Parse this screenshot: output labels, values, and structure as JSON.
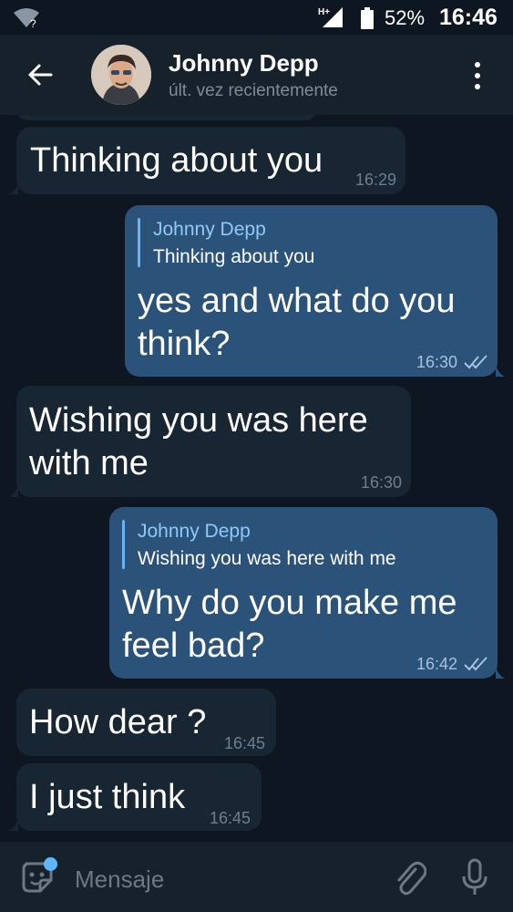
{
  "status_bar": {
    "wifi_icon": "wifi-unknown-icon",
    "network": "H+",
    "battery_percent": "52%",
    "time": "16:46"
  },
  "header": {
    "contact_name": "Johnny Depp",
    "last_seen": "últ. vez recientemente"
  },
  "messages": [
    {
      "direction": "in",
      "text": "Thinking about you",
      "time": "16:29"
    },
    {
      "direction": "out",
      "reply_name": "Johnny Depp",
      "reply_text": "Thinking about you",
      "line1": "yes and what do you",
      "line2": "think?",
      "time": "16:30",
      "read": true
    },
    {
      "direction": "in",
      "line1": "Wishing you was here",
      "line2": "with me",
      "time": "16:30"
    },
    {
      "direction": "out",
      "reply_name": "Johnny Depp",
      "reply_text": "Wishing you was here with me",
      "line1": "Why do you make me",
      "line2": "feel bad?",
      "time": "16:42",
      "read": true
    },
    {
      "direction": "in",
      "text": "How dear ?",
      "time": "16:45"
    },
    {
      "direction": "in",
      "text": "I just think",
      "time": "16:45"
    }
  ],
  "input": {
    "placeholder": "Mensaje"
  },
  "colors": {
    "background": "#0e1621",
    "header": "#17212b",
    "incoming_bubble": "#182533",
    "outgoing_bubble": "#2b5278",
    "accent": "#5eb5f7"
  }
}
